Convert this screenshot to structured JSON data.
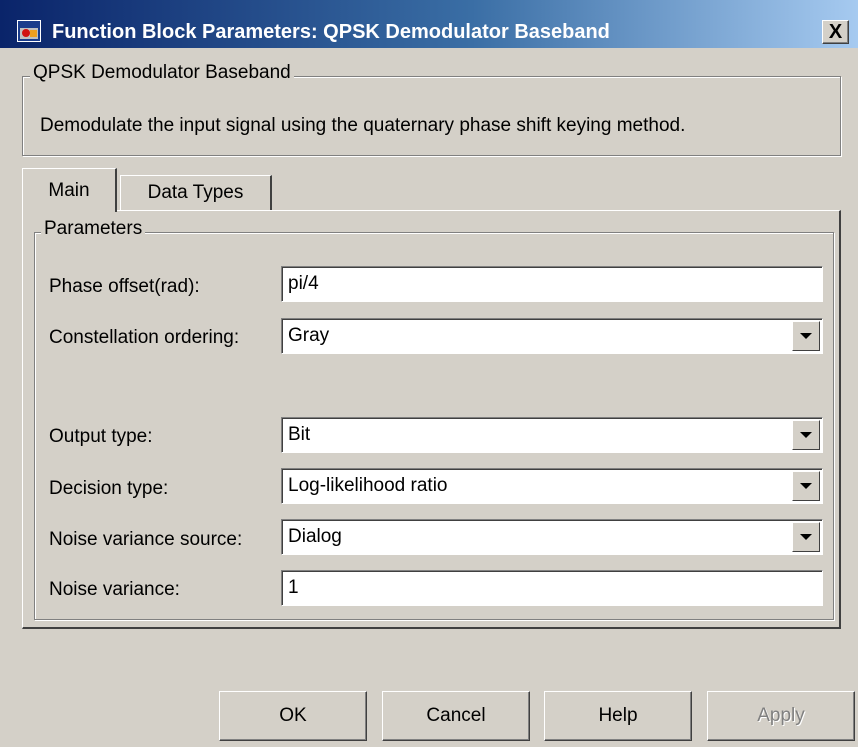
{
  "window": {
    "title": "Function Block Parameters: QPSK Demodulator Baseband",
    "close_label": "X"
  },
  "block": {
    "name": "QPSK Demodulator Baseband",
    "description": "Demodulate the input signal using the quaternary phase shift keying method."
  },
  "tabs": [
    {
      "label": "Main",
      "selected": true
    },
    {
      "label": "Data Types",
      "selected": false
    }
  ],
  "parameters": {
    "group_title": "Parameters",
    "phase_offset": {
      "label": "Phase offset(rad):",
      "value": "pi/4"
    },
    "constellation_ordering": {
      "label": "Constellation ordering:",
      "value": "Gray"
    },
    "output_type": {
      "label": "Output type:",
      "value": "Bit"
    },
    "decision_type": {
      "label": "Decision type:",
      "value": "Log-likelihood ratio"
    },
    "noise_variance_source": {
      "label": "Noise variance source:",
      "value": "Dialog"
    },
    "noise_variance": {
      "label": "Noise variance:",
      "value": "1"
    }
  },
  "buttons": {
    "ok": "OK",
    "cancel": "Cancel",
    "help": "Help",
    "apply": "Apply",
    "apply_enabled": false
  },
  "colors": {
    "titlebar_start": "#0a246a",
    "titlebar_end": "#a6caf0",
    "dialog_bg": "#d4d0c8"
  }
}
